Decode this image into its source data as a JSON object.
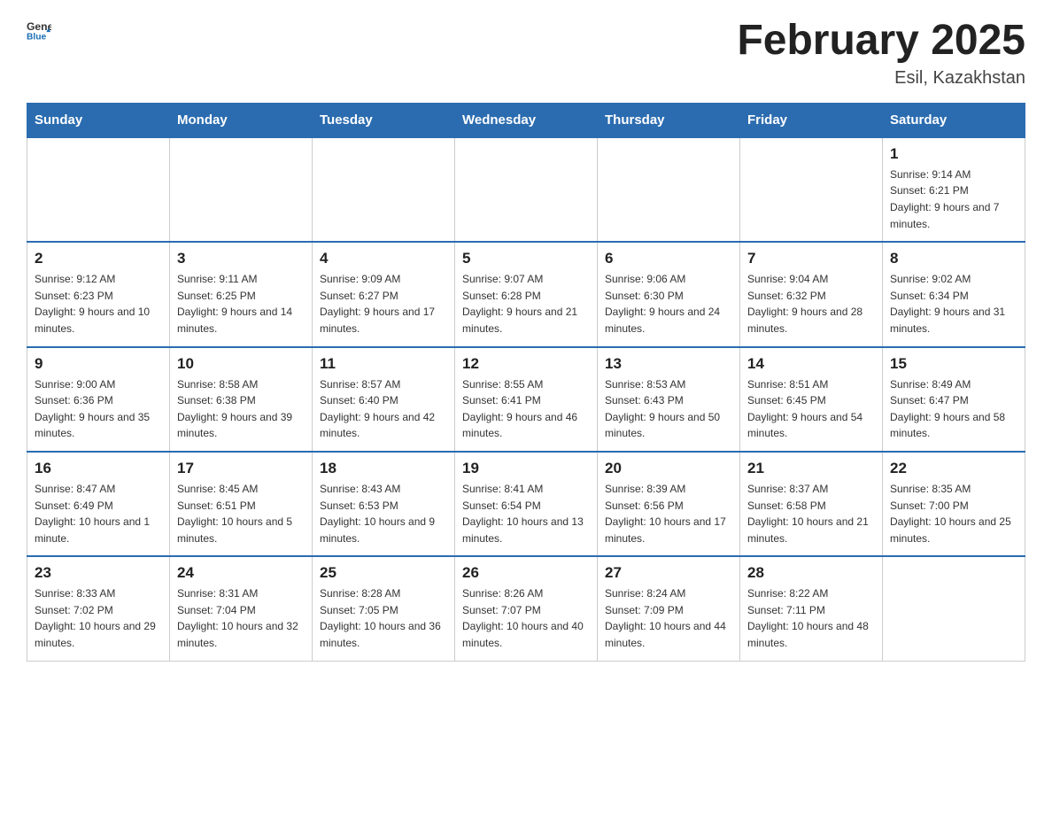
{
  "logo": {
    "general": "General",
    "blue": "Blue"
  },
  "title": "February 2025",
  "subtitle": "Esil, Kazakhstan",
  "weekdays": [
    "Sunday",
    "Monday",
    "Tuesday",
    "Wednesday",
    "Thursday",
    "Friday",
    "Saturday"
  ],
  "weeks": [
    [
      {
        "day": "",
        "info": ""
      },
      {
        "day": "",
        "info": ""
      },
      {
        "day": "",
        "info": ""
      },
      {
        "day": "",
        "info": ""
      },
      {
        "day": "",
        "info": ""
      },
      {
        "day": "",
        "info": ""
      },
      {
        "day": "1",
        "info": "Sunrise: 9:14 AM\nSunset: 6:21 PM\nDaylight: 9 hours and 7 minutes."
      }
    ],
    [
      {
        "day": "2",
        "info": "Sunrise: 9:12 AM\nSunset: 6:23 PM\nDaylight: 9 hours and 10 minutes."
      },
      {
        "day": "3",
        "info": "Sunrise: 9:11 AM\nSunset: 6:25 PM\nDaylight: 9 hours and 14 minutes."
      },
      {
        "day": "4",
        "info": "Sunrise: 9:09 AM\nSunset: 6:27 PM\nDaylight: 9 hours and 17 minutes."
      },
      {
        "day": "5",
        "info": "Sunrise: 9:07 AM\nSunset: 6:28 PM\nDaylight: 9 hours and 21 minutes."
      },
      {
        "day": "6",
        "info": "Sunrise: 9:06 AM\nSunset: 6:30 PM\nDaylight: 9 hours and 24 minutes."
      },
      {
        "day": "7",
        "info": "Sunrise: 9:04 AM\nSunset: 6:32 PM\nDaylight: 9 hours and 28 minutes."
      },
      {
        "day": "8",
        "info": "Sunrise: 9:02 AM\nSunset: 6:34 PM\nDaylight: 9 hours and 31 minutes."
      }
    ],
    [
      {
        "day": "9",
        "info": "Sunrise: 9:00 AM\nSunset: 6:36 PM\nDaylight: 9 hours and 35 minutes."
      },
      {
        "day": "10",
        "info": "Sunrise: 8:58 AM\nSunset: 6:38 PM\nDaylight: 9 hours and 39 minutes."
      },
      {
        "day": "11",
        "info": "Sunrise: 8:57 AM\nSunset: 6:40 PM\nDaylight: 9 hours and 42 minutes."
      },
      {
        "day": "12",
        "info": "Sunrise: 8:55 AM\nSunset: 6:41 PM\nDaylight: 9 hours and 46 minutes."
      },
      {
        "day": "13",
        "info": "Sunrise: 8:53 AM\nSunset: 6:43 PM\nDaylight: 9 hours and 50 minutes."
      },
      {
        "day": "14",
        "info": "Sunrise: 8:51 AM\nSunset: 6:45 PM\nDaylight: 9 hours and 54 minutes."
      },
      {
        "day": "15",
        "info": "Sunrise: 8:49 AM\nSunset: 6:47 PM\nDaylight: 9 hours and 58 minutes."
      }
    ],
    [
      {
        "day": "16",
        "info": "Sunrise: 8:47 AM\nSunset: 6:49 PM\nDaylight: 10 hours and 1 minute."
      },
      {
        "day": "17",
        "info": "Sunrise: 8:45 AM\nSunset: 6:51 PM\nDaylight: 10 hours and 5 minutes."
      },
      {
        "day": "18",
        "info": "Sunrise: 8:43 AM\nSunset: 6:53 PM\nDaylight: 10 hours and 9 minutes."
      },
      {
        "day": "19",
        "info": "Sunrise: 8:41 AM\nSunset: 6:54 PM\nDaylight: 10 hours and 13 minutes."
      },
      {
        "day": "20",
        "info": "Sunrise: 8:39 AM\nSunset: 6:56 PM\nDaylight: 10 hours and 17 minutes."
      },
      {
        "day": "21",
        "info": "Sunrise: 8:37 AM\nSunset: 6:58 PM\nDaylight: 10 hours and 21 minutes."
      },
      {
        "day": "22",
        "info": "Sunrise: 8:35 AM\nSunset: 7:00 PM\nDaylight: 10 hours and 25 minutes."
      }
    ],
    [
      {
        "day": "23",
        "info": "Sunrise: 8:33 AM\nSunset: 7:02 PM\nDaylight: 10 hours and 29 minutes."
      },
      {
        "day": "24",
        "info": "Sunrise: 8:31 AM\nSunset: 7:04 PM\nDaylight: 10 hours and 32 minutes."
      },
      {
        "day": "25",
        "info": "Sunrise: 8:28 AM\nSunset: 7:05 PM\nDaylight: 10 hours and 36 minutes."
      },
      {
        "day": "26",
        "info": "Sunrise: 8:26 AM\nSunset: 7:07 PM\nDaylight: 10 hours and 40 minutes."
      },
      {
        "day": "27",
        "info": "Sunrise: 8:24 AM\nSunset: 7:09 PM\nDaylight: 10 hours and 44 minutes."
      },
      {
        "day": "28",
        "info": "Sunrise: 8:22 AM\nSunset: 7:11 PM\nDaylight: 10 hours and 48 minutes."
      },
      {
        "day": "",
        "info": ""
      }
    ]
  ]
}
